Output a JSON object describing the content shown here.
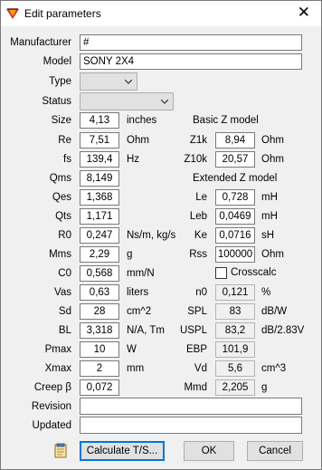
{
  "window": {
    "title": "Edit parameters",
    "close_glyph": "✕"
  },
  "fields": {
    "manufacturer": {
      "label": "Manufacturer",
      "value": "#"
    },
    "model": {
      "label": "Model",
      "value": "SONY 2X4"
    },
    "type": {
      "label": "Type",
      "value": ""
    },
    "status": {
      "label": "Status",
      "value": ""
    },
    "revision": {
      "label": "Revision",
      "value": ""
    },
    "updated": {
      "label": "Updated",
      "value": ""
    }
  },
  "left_params": [
    {
      "label": "Size",
      "value": "4,13",
      "unit": "inches"
    },
    {
      "label": "Re",
      "value": "7,51",
      "unit": "Ohm"
    },
    {
      "label": "fs",
      "value": "139,4",
      "unit": "Hz"
    },
    {
      "label": "Qms",
      "value": "8,149",
      "unit": ""
    },
    {
      "label": "Qes",
      "value": "1,368",
      "unit": ""
    },
    {
      "label": "Qts",
      "value": "1,171",
      "unit": ""
    },
    {
      "label": "R0",
      "value": "0,247",
      "unit": "Ns/m, kg/s"
    },
    {
      "label": "Mms",
      "value": "2,29",
      "unit": "g"
    },
    {
      "label": "C0",
      "value": "0,568",
      "unit": "mm/N"
    },
    {
      "label": "Vas",
      "value": "0,63",
      "unit": "liters"
    },
    {
      "label": "Sd",
      "value": "28",
      "unit": "cm^2"
    },
    {
      "label": "BL",
      "value": "3,318",
      "unit": "N/A, Tm"
    },
    {
      "label": "Pmax",
      "value": "10",
      "unit": "W"
    },
    {
      "label": "Xmax",
      "value": "2",
      "unit": "mm"
    },
    {
      "label": "Creep β",
      "value": "0,072",
      "unit": ""
    }
  ],
  "basic_z": {
    "heading": "Basic Z model",
    "params": [
      {
        "label": "Z1k",
        "value": "8,94",
        "unit": "Ohm"
      },
      {
        "label": "Z10k",
        "value": "20,57",
        "unit": "Ohm"
      }
    ]
  },
  "extended_z": {
    "heading": "Extended Z model",
    "params": [
      {
        "label": "Le",
        "value": "0,728",
        "unit": "mH"
      },
      {
        "label": "Leb",
        "value": "0,0469",
        "unit": "mH"
      },
      {
        "label": "Ke",
        "value": "0,0716",
        "unit": "sH"
      },
      {
        "label": "Rss",
        "value": "100000",
        "unit": "Ohm"
      }
    ]
  },
  "crosscalc": {
    "label": "Crosscalc",
    "checked": false
  },
  "calc_params": [
    {
      "label": "n0",
      "value": "0,121",
      "unit": "%"
    },
    {
      "label": "SPL",
      "value": "83",
      "unit": "dB/W"
    },
    {
      "label": "USPL",
      "value": "83,2",
      "unit": "dB/2.83V"
    },
    {
      "label": "EBP",
      "value": "101,9",
      "unit": ""
    },
    {
      "label": "Vd",
      "value": "5,6",
      "unit": "cm^3"
    },
    {
      "label": "Mmd",
      "value": "2,205",
      "unit": "g"
    }
  ],
  "buttons": {
    "calculate": "Calculate T/S...",
    "ok": "OK",
    "cancel": "Cancel"
  }
}
